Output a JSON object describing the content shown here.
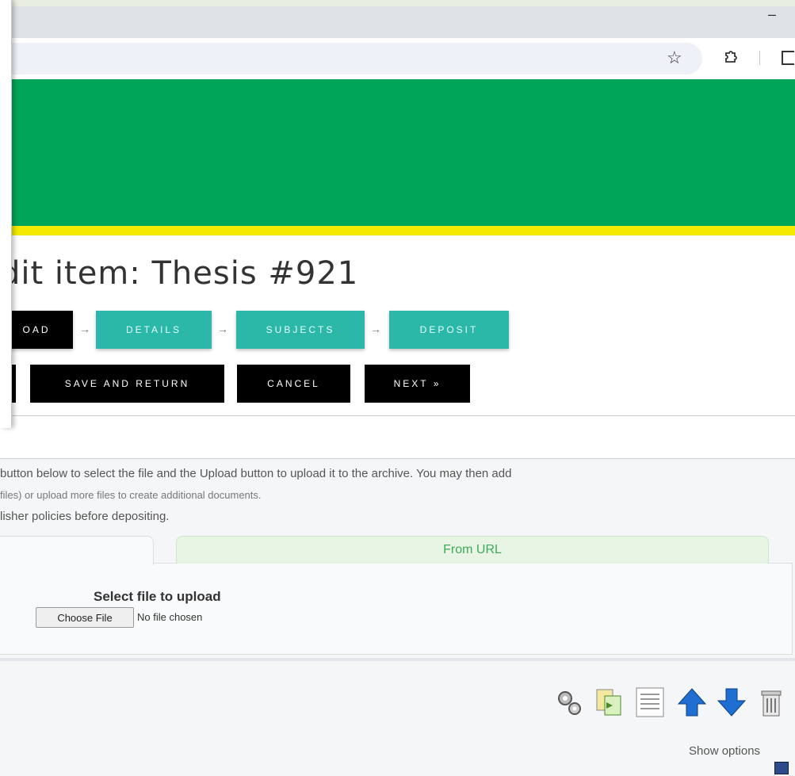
{
  "browser": {
    "minimize": "–",
    "star_icon": "star-icon",
    "extensions_icon": "puzzle-icon"
  },
  "page": {
    "title": "dit item: Thesis #921",
    "steps": [
      {
        "label": "OAD"
      },
      {
        "label": "DETAILS"
      },
      {
        "label": "SUBJECTS"
      },
      {
        "label": "DEPOSIT"
      }
    ],
    "step_arrow": "→",
    "buttons": {
      "save_return": "SAVE AND RETURN",
      "cancel": "CANCEL",
      "next": "NEXT »"
    }
  },
  "instructions": [
    "button below to select the file and the Upload button to upload it to the archive. You may then add",
    "files) or upload more files to create additional documents.",
    "lisher policies before depositing."
  ],
  "upload": {
    "tab_url": "From URL",
    "select_label": "Select file to upload",
    "choose_button": "Choose File",
    "no_file": "No file chosen"
  },
  "actions": {
    "show_options": "Show options"
  },
  "colors": {
    "banner": "#00a55a",
    "banner_stripe": "#f6e900",
    "step": "#2bb8a8",
    "active_step": "#000000"
  }
}
